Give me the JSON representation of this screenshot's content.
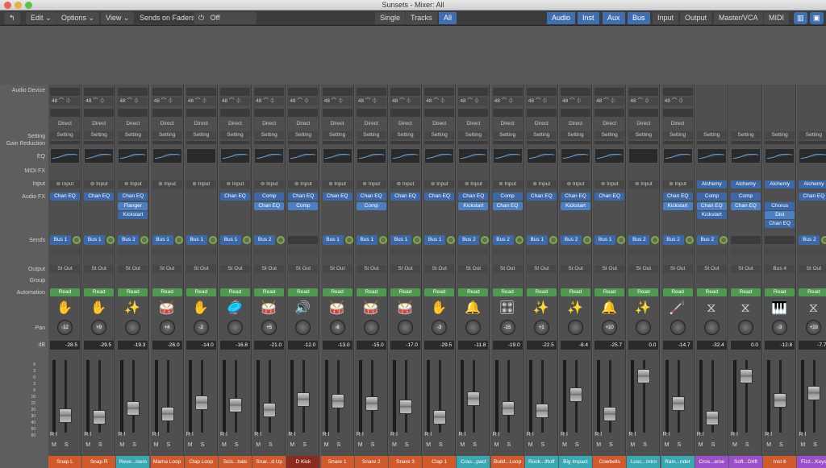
{
  "window": {
    "title": "Sunsets - Mixer: All"
  },
  "toolbar": {
    "edit": "Edit",
    "options": "Options",
    "view": "View",
    "sends_on_faders_label": "Sends on Faders:",
    "sends_on_faders_value": "Off",
    "single": "Single",
    "tracks": "Tracks",
    "all": "All",
    "filters": [
      "Audio",
      "Inst",
      "Aux",
      "Bus",
      "Input",
      "Output",
      "Master/VCA",
      "MIDI"
    ]
  },
  "row_labels": {
    "audio_device": "Audio Device",
    "setting": "Setting",
    "gain_reduction": "Gain Reduction",
    "eq": "EQ",
    "midi_fx": "MIDI FX",
    "input": "Input",
    "audio_fx": "Audio FX",
    "sends": "Sends",
    "output": "Output",
    "group": "Group",
    "automation": "Automation",
    "pan": "Pan",
    "db": "dB"
  },
  "meter_scale": [
    "6",
    "3",
    "0",
    "3",
    "6",
    "10",
    "15",
    "20",
    "30",
    "40",
    "50",
    "60"
  ],
  "common": {
    "sample_rate": "48",
    "direct": "Direct",
    "setting": "Setting",
    "read": "Read",
    "r": "R",
    "i": "I",
    "m": "M",
    "s": "S"
  },
  "strips": [
    {
      "name": "Snap L",
      "color": "#d05a2c",
      "icon": "hand",
      "input": "Input",
      "fx": [
        "Chan EQ"
      ],
      "send": "Bus 1",
      "output": "St Out",
      "pan": "-12",
      "db": "-28.5",
      "fader": 0.18
    },
    {
      "name": "Snap R",
      "color": "#d05a2c",
      "icon": "hand",
      "input": "Input",
      "fx": [
        "Chan EQ"
      ],
      "send": "Bus 1",
      "output": "St Out",
      "pan": "+9",
      "db": "-29.5",
      "fader": 0.16
    },
    {
      "name": "Reve...isers",
      "color": "#3aa8b2",
      "icon": "sparkle",
      "input": "Input",
      "fx": [
        "Chan EQ",
        "Flanger",
        "Kickstart"
      ],
      "send": "Bus 2",
      "output": "St Out",
      "pan": "",
      "db": "-19.3",
      "fader": 0.28
    },
    {
      "name": "Mama Loop",
      "color": "#d05a2c",
      "icon": "drum-loop",
      "input": "Input",
      "fx": [],
      "send": "Bus 1",
      "output": "St Out",
      "pan": "+4",
      "db": "-26.0",
      "fader": 0.2
    },
    {
      "name": "Clap Loop",
      "color": "#d05a2c",
      "icon": "hand",
      "input": "Input",
      "fx": [],
      "send": "Bus 1",
      "output": "St Out",
      "pan": "-2",
      "db": "-14.0",
      "fader": 0.36
    },
    {
      "name": "Scis...bals",
      "color": "#d05a2c",
      "icon": "cymbal",
      "input": "Input",
      "fx": [
        "Chan EQ"
      ],
      "send": "Bus 1",
      "output": "St Out",
      "pan": "",
      "db": "-16.8",
      "fader": 0.32
    },
    {
      "name": "Snar...d Up",
      "color": "#d05a2c",
      "icon": "snare",
      "input": "Input",
      "fx": [
        "Comp",
        "Chan EQ"
      ],
      "send": "Bus 2",
      "output": "St Out",
      "pan": "+5",
      "db": "-21.0",
      "fader": 0.26
    },
    {
      "name": "D Kick",
      "color": "#8a2b1e",
      "icon": "kick",
      "input": "Input",
      "fx": [
        "Chan EQ",
        "Comp"
      ],
      "send": "",
      "output": "St Out",
      "pan": "",
      "db": "-12.0",
      "fader": 0.4
    },
    {
      "name": "Snare 1",
      "color": "#d05a2c",
      "icon": "snare",
      "input": "Input",
      "fx": [
        "Chan EQ"
      ],
      "send": "Bus 1",
      "output": "St Out",
      "pan": "-6",
      "db": "-13.0",
      "fader": 0.38
    },
    {
      "name": "Snare 2",
      "color": "#d05a2c",
      "icon": "snare",
      "input": "Input",
      "fx": [
        "Chan EQ",
        "Comp"
      ],
      "send": "Bus 1",
      "output": "St Out",
      "pan": "",
      "db": "-15.0",
      "fader": 0.34
    },
    {
      "name": "Snare 3",
      "color": "#d05a2c",
      "icon": "snare",
      "input": "Input",
      "fx": [
        "Chan EQ"
      ],
      "send": "Bus 1",
      "output": "St Out",
      "pan": "",
      "db": "-17.0",
      "fader": 0.3
    },
    {
      "name": "Clap 1",
      "color": "#d05a2c",
      "icon": "hand",
      "input": "Input",
      "fx": [
        "Chan EQ"
      ],
      "send": "Bus 1",
      "output": "St Out",
      "pan": "-3",
      "db": "-29.5",
      "fader": 0.16
    },
    {
      "name": "Cras...pact",
      "color": "#3aa8b2",
      "icon": "crash",
      "input": "Input",
      "fx": [
        "Chan EQ",
        "Kickstart"
      ],
      "send": "Bus 2",
      "output": "St Out",
      "pan": "",
      "db": "-11.8",
      "fader": 0.41
    },
    {
      "name": "Build...Loop",
      "color": "#d05a2c",
      "icon": "kit",
      "input": "Input",
      "fx": [
        "Comp",
        "Chan EQ"
      ],
      "send": "Bus 2",
      "output": "St Out",
      "pan": "-15",
      "db": "-19.0",
      "fader": 0.28
    },
    {
      "name": "Rock...iftoff",
      "color": "#3aa8b2",
      "icon": "sparkle",
      "input": "Input",
      "fx": [
        "Chan EQ"
      ],
      "send": "Bus 1",
      "output": "St Out",
      "pan": "+1",
      "db": "-22.5",
      "fader": 0.24
    },
    {
      "name": "Big Impact",
      "color": "#3aa8b2",
      "icon": "sparkle",
      "input": "Input",
      "fx": [
        "Chan EQ",
        "Kickstart"
      ],
      "send": "Bus 2",
      "output": "St Out",
      "pan": "",
      "db": "-8.4",
      "fader": 0.47
    },
    {
      "name": "Cowbells",
      "color": "#d05a2c",
      "icon": "cowbell",
      "input": "Input",
      "fx": [
        "Chan EQ"
      ],
      "send": "Bus 1",
      "output": "St Out",
      "pan": "+10",
      "db": "-25.7",
      "fader": 0.2
    },
    {
      "name": "Lusc...Intro",
      "color": "#3aa8b2",
      "icon": "sparkle",
      "input": "Input",
      "fx": [],
      "send": "Bus 2",
      "output": "St Out",
      "pan": "",
      "db": "0.0",
      "fader": 0.72
    },
    {
      "name": "Rain...nder",
      "color": "#3aa8b2",
      "icon": "rainstick",
      "input": "Input",
      "fx": [
        "Chan EQ",
        "Kickstart"
      ],
      "send": "Bus 2",
      "output": "St Out",
      "pan": "",
      "db": "-14.7",
      "fader": 0.35
    },
    {
      "name": "Cros...erse",
      "color": "#9b4fc9",
      "icon": "synth",
      "input": "Alchemy",
      "fx": [
        "Comp",
        "Chan EQ",
        "Kickstart"
      ],
      "send": "Bus 2",
      "output": "St Out",
      "pan": "",
      "db": "-32.4",
      "fader": 0.14
    },
    {
      "name": "Soft...Drift",
      "color": "#9b4fc9",
      "icon": "synth",
      "input": "Alchemy",
      "fx": [
        "Comp",
        "Chan EQ"
      ],
      "send": "",
      "output": "St Out",
      "pan": "",
      "db": "0.0",
      "fader": 0.72
    },
    {
      "name": "Inst 6",
      "color": "#d05a2c",
      "icon": "keys",
      "input": "Alchemy",
      "fx": [
        "Chorus",
        "Dist",
        "Chan EQ"
      ],
      "send": "",
      "output": "Bus 4",
      "pan": "-3",
      "db": "-12.8",
      "fader": 0.39
    },
    {
      "name": "Fizz...Keys",
      "color": "#9b4fc9",
      "icon": "synth",
      "input": "Alchemy",
      "fx": [
        "Chan EQ"
      ],
      "send": "Bus 2",
      "output": "St Out",
      "pan": "+28",
      "db": "-7.7",
      "fader": 0.49
    }
  ],
  "icons": {
    "hand": "✋",
    "sparkle": "✨",
    "drum-loop": "🥁",
    "cymbal": "🥏",
    "snare": "🥁",
    "kick": "🔊",
    "crash": "🔔",
    "kit": "🎛",
    "cowbell": "🔔",
    "rainstick": "🦯",
    "synth": "⧖",
    "keys": "🎹"
  }
}
